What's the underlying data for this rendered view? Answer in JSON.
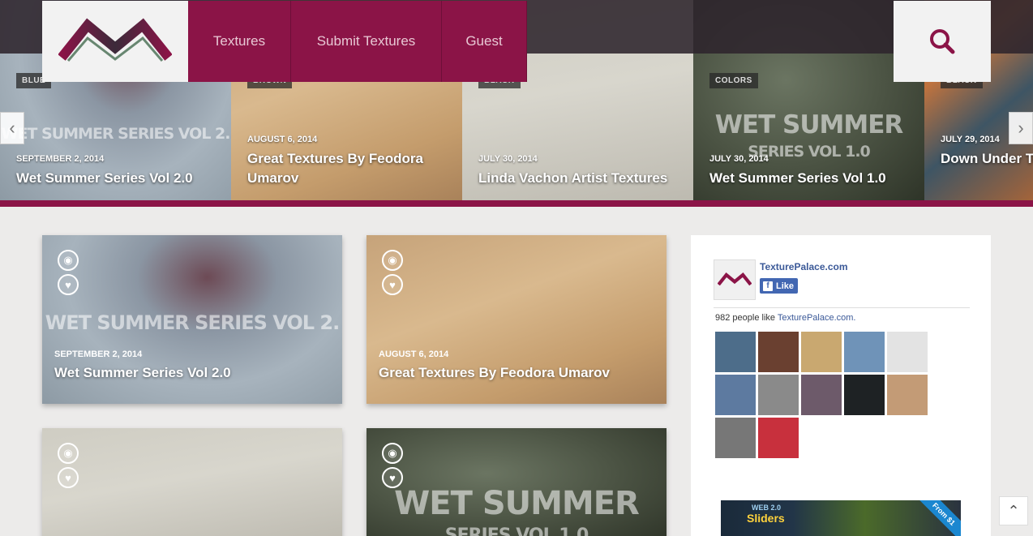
{
  "header": {
    "nav": [
      {
        "label": "Textures"
      },
      {
        "label": "Submit Textures"
      },
      {
        "label": "Guest"
      }
    ]
  },
  "slider": {
    "slides": [
      {
        "category": "BLUE",
        "watermark": "WET SUMMER SERIES VOL 2.",
        "date": "SEPTEMBER 2, 2014",
        "title": "Wet Summer Series Vol 2.0"
      },
      {
        "category": "BROWN",
        "watermark": "",
        "date": "AUGUST 6, 2014",
        "title": "Great Textures By Feodora Umarov"
      },
      {
        "category": "BLACK",
        "watermark": "",
        "date": "JULY 30, 2014",
        "title": "Linda Vachon Artist Textures"
      },
      {
        "category": "COLORS",
        "watermark": "WET SUMMER",
        "watermark2": "SERIES VOL 1.0",
        "date": "JULY 30, 2014",
        "title": "Wet Summer Series Vol 1.0"
      },
      {
        "category": "BLACK",
        "watermark": "",
        "date": "JULY 29, 2014",
        "title": "Down Under Te Dietmar"
      }
    ]
  },
  "cards": [
    {
      "watermark": "WET SUMMER SERIES VOL 2.",
      "date": "SEPTEMBER 2, 2014",
      "title": "Wet Summer Series Vol 2.0"
    },
    {
      "watermark": "",
      "date": "AUGUST 6, 2014",
      "title": "Great Textures By Feodora Umarov"
    },
    {
      "watermark": "",
      "date": "",
      "title": ""
    },
    {
      "watermark": "WET SUMMER",
      "watermark2": "SERIES VOL 1.0",
      "date": "",
      "title": ""
    }
  ],
  "facebook": {
    "page_name": "TexturePalace.com",
    "like_label": "Like",
    "count_prefix": "982 people like ",
    "count_link": "TexturePalace.com.",
    "faces": [
      "#4d6d8a",
      "#6a4030",
      "#c9a870",
      "#6f93b8",
      "#e3e3e3",
      "#5d7aa0",
      "#8a8a8a",
      "#6d5a6a",
      "#1e2224",
      "#c39b76",
      "#777777",
      "#c8303d"
    ]
  },
  "ad": {
    "line1": "WEB 2.0",
    "line2": "Sliders",
    "ribbon": "From $1"
  },
  "icons": {
    "search": "search-icon",
    "prev": "chevron-left-icon",
    "next": "chevron-right-icon",
    "view": "eye-icon",
    "like": "heart-icon",
    "top": "chevron-up-icon"
  },
  "colors": {
    "brand": "#8b1447",
    "facebook": "#4267b2"
  }
}
